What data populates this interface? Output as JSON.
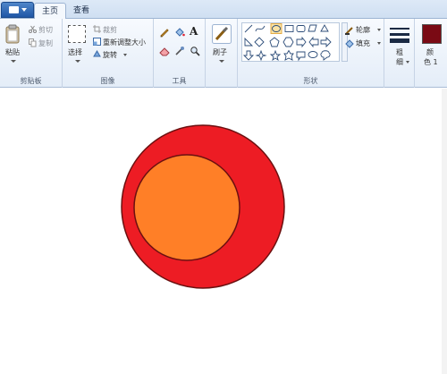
{
  "tabs": [
    {
      "label": "主页"
    },
    {
      "label": "查看"
    }
  ],
  "clipboard": {
    "paste": "粘贴",
    "cut": "剪切",
    "copy": "复制",
    "group": "剪贴板"
  },
  "image": {
    "select": "选择",
    "crop": "裁剪",
    "resize": "重新调整大小",
    "rotate": "旋转",
    "group": "图像"
  },
  "tools": {
    "text_glyph": "A",
    "group": "工具"
  },
  "brush": {
    "label": "刷子"
  },
  "shapes": {
    "outline": "轮廓",
    "fill": "填充",
    "group": "形状"
  },
  "size": {
    "label_1": "粗",
    "label_2": "细"
  },
  "color": {
    "label_1": "颜",
    "label_2": "色 1",
    "value": "#7a0a14"
  },
  "drawing": {
    "outer_fill": "#ed1c24",
    "inner_fill": "#ff7f27",
    "stroke": "#6b1010"
  }
}
